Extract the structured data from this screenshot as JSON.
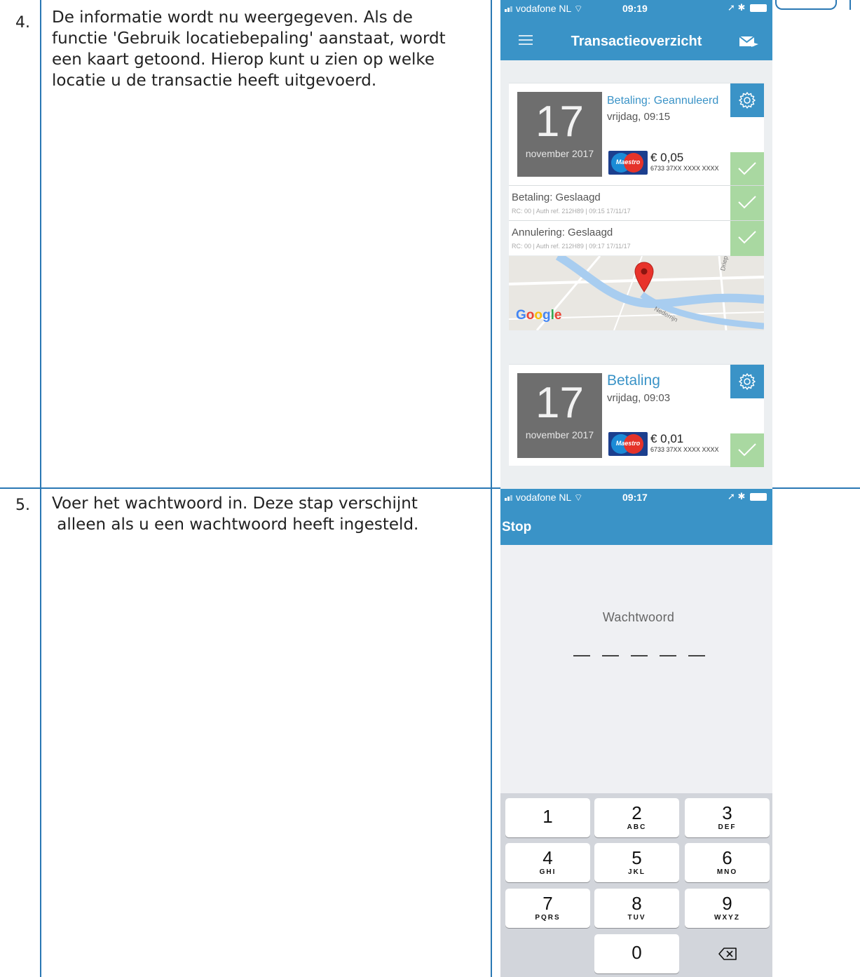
{
  "steps": [
    {
      "number": "4.",
      "lines": [
        "De informatie wordt nu weergegeven. Als de",
        "functie 'Gebruik locatiebepaling' aanstaat, wordt",
        "een kaart getoond. Hierop kunt u zien op welke",
        "locatie u de transactie heeft uitgevoerd."
      ]
    },
    {
      "number": "5.",
      "lines": [
        "Voer het wachtwoord in. Deze stap verschijnt",
        " alleen als u een wachtwoord heeft ingesteld."
      ]
    }
  ],
  "screen1": {
    "status": {
      "carrier": "vodafone NL",
      "time": "09:19"
    },
    "title": "Transactieoverzicht",
    "transactions": [
      {
        "day": "17",
        "month": "november 2017",
        "title": "Betaling: Geannuleerd",
        "weekday_time": "vrijdag, 09:15",
        "card_brand": "Maestro",
        "amount": "€ 0,05",
        "card_number": "6733 37XX XXXX XXXX",
        "events": [
          {
            "title": "Betaling: Geslaagd",
            "meta": "RC: 00 | Auth ref. 212H89 | 09:15 17/11/17"
          },
          {
            "title": "Annulering: Geslaagd",
            "meta": "RC: 00 | Auth ref. 212H89 | 09:17 17/11/17"
          }
        ]
      },
      {
        "day": "17",
        "month": "november 2017",
        "title": "Betaling",
        "weekday_time": "vrijdag, 09:03",
        "card_brand": "Maestro",
        "amount": "€ 0,01",
        "card_number": "6733 37XX XXXX XXXX"
      }
    ],
    "map": {
      "logo": "Google",
      "streets": [
        "Driepoort",
        "Nederrijn"
      ]
    }
  },
  "screen2": {
    "status": {
      "carrier": "vodafone NL",
      "time": "09:17"
    },
    "stop_label": "Stop",
    "password_label": "Wachtwoord",
    "keys": [
      {
        "n": "1",
        "l": ""
      },
      {
        "n": "2",
        "l": "ABC"
      },
      {
        "n": "3",
        "l": "DEF"
      },
      {
        "n": "4",
        "l": "GHI"
      },
      {
        "n": "5",
        "l": "JKL"
      },
      {
        "n": "6",
        "l": "MNO"
      },
      {
        "n": "7",
        "l": "PQRS"
      },
      {
        "n": "8",
        "l": "TUV"
      },
      {
        "n": "9",
        "l": "WXYZ"
      },
      {
        "n": "0",
        "l": ""
      }
    ]
  },
  "colors": {
    "accent": "#3a93c7",
    "table_border": "#2a78b4",
    "success": "#a9d8a1",
    "date_tile": "#6e6e6e"
  }
}
